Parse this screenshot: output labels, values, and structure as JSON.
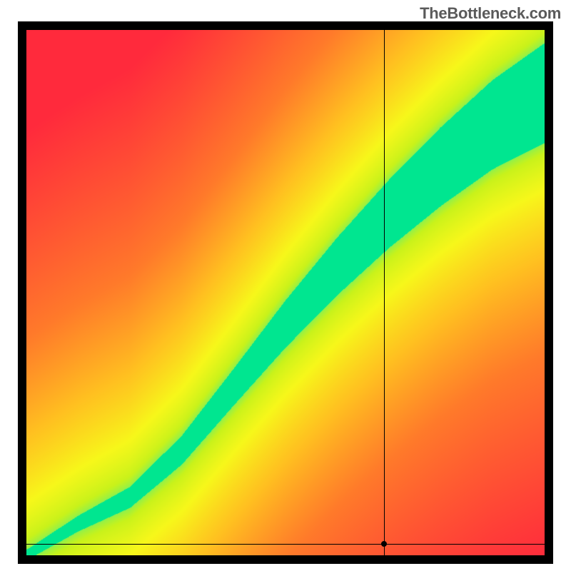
{
  "watermark": "TheBottleneck.com",
  "chart_data": {
    "type": "heatmap",
    "title": "",
    "xlabel": "",
    "ylabel": "",
    "xlim": [
      0,
      1
    ],
    "ylim": [
      0,
      1
    ],
    "crosshair": {
      "x": 0.69,
      "y": 0.022
    },
    "ridge": {
      "description": "Green optimal band runs roughly along a curved diagonal; red regions far from diagonal indicate mismatch.",
      "points": [
        {
          "x": 0.0,
          "y": 0.0
        },
        {
          "x": 0.1,
          "y": 0.06
        },
        {
          "x": 0.2,
          "y": 0.11
        },
        {
          "x": 0.3,
          "y": 0.2
        },
        {
          "x": 0.4,
          "y": 0.32
        },
        {
          "x": 0.5,
          "y": 0.44
        },
        {
          "x": 0.6,
          "y": 0.55
        },
        {
          "x": 0.7,
          "y": 0.65
        },
        {
          "x": 0.8,
          "y": 0.74
        },
        {
          "x": 0.9,
          "y": 0.82
        },
        {
          "x": 1.0,
          "y": 0.88
        }
      ],
      "half_width_normalized": [
        {
          "x": 0.0,
          "w": 0.01
        },
        {
          "x": 0.2,
          "w": 0.02
        },
        {
          "x": 0.4,
          "w": 0.035
        },
        {
          "x": 0.6,
          "w": 0.055
        },
        {
          "x": 0.8,
          "w": 0.075
        },
        {
          "x": 1.0,
          "w": 0.095
        }
      ]
    },
    "colorscale": [
      {
        "stop": 0.0,
        "color": "#ff2a3c"
      },
      {
        "stop": 0.35,
        "color": "#ff7a2a"
      },
      {
        "stop": 0.55,
        "color": "#ffc020"
      },
      {
        "stop": 0.72,
        "color": "#f7f71a"
      },
      {
        "stop": 0.85,
        "color": "#c9f21a"
      },
      {
        "stop": 0.93,
        "color": "#7ef05a"
      },
      {
        "stop": 1.0,
        "color": "#00e690"
      }
    ]
  }
}
